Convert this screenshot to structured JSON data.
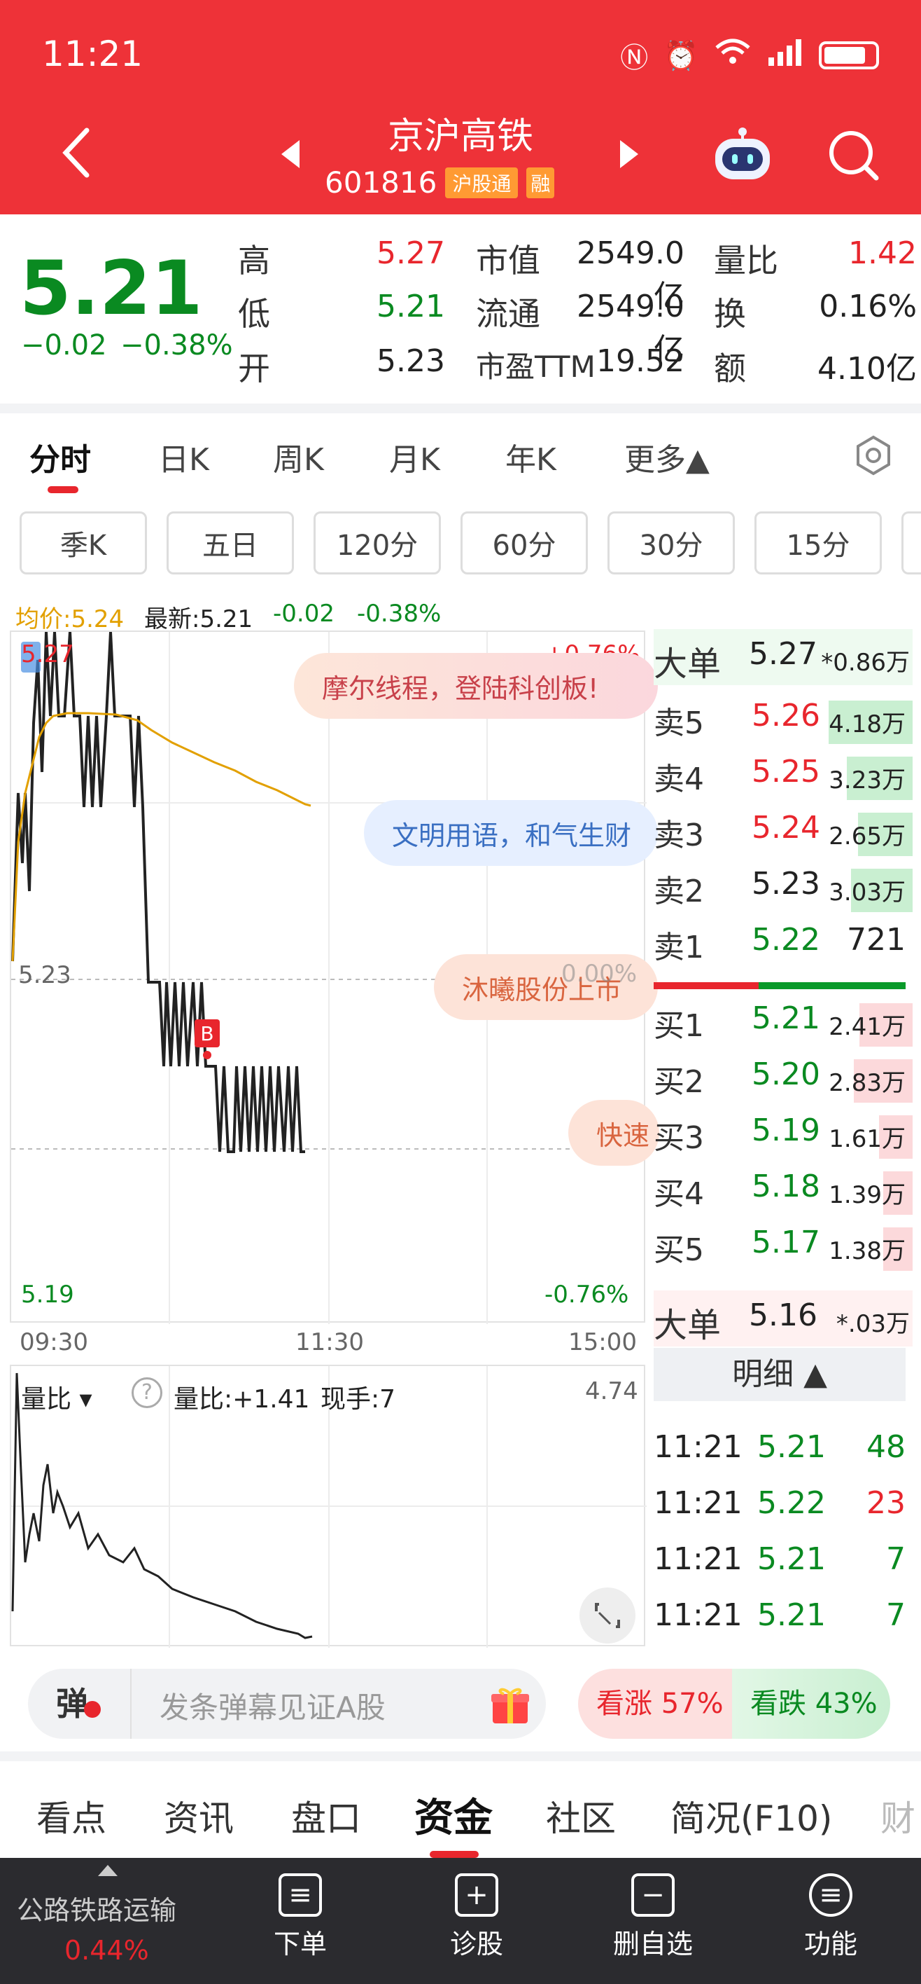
{
  "status": {
    "time": "11:21"
  },
  "header": {
    "title": "京沪高铁",
    "code": "601816",
    "tag_hgt": "沪股通",
    "tag_rong": "融"
  },
  "quote": {
    "price": "5.21",
    "change": "−0.02",
    "change_pct": "−0.38%",
    "high_label": "高",
    "high": "5.27",
    "low_label": "低",
    "low": "5.21",
    "open_label": "开",
    "open": "5.23",
    "mktcap_label": "市值",
    "mktcap": "2549.0亿",
    "float_label": "流通",
    "float": "2549.0亿",
    "pe_label": "市盈TTM",
    "pe": "19.52",
    "volratio_label": "量比",
    "volratio": "1.42",
    "turnover_label": "换",
    "turnover": "0.16%",
    "amount_label": "额",
    "amount": "4.10亿"
  },
  "period_tabs": [
    "分时",
    "日K",
    "周K",
    "月K",
    "年K",
    "更多▲"
  ],
  "period_pills": [
    "季K",
    "五日",
    "120分",
    "60分",
    "30分",
    "15分"
  ],
  "chart_info": {
    "avg": "均价:5.24",
    "latest": "最新:5.21",
    "chg": "-0.02",
    "pct": "-0.38%"
  },
  "chart_axes": {
    "y_top": "5.27",
    "y_mid": "5.23",
    "y_bottom": "5.19",
    "pct_top": "+0.76%",
    "pct_mid": "0.00%",
    "pct_bottom": "-0.76%",
    "x_start": "09:30",
    "x_mid": "11:30",
    "x_end": "15:00",
    "b_marker": "B"
  },
  "bubbles": [
    "摩尔线程，登陆科创板!",
    "文明用语，和气生财",
    "沐曦股份上市",
    "快速"
  ],
  "volume": {
    "selector": "量比",
    "ratio": "量比:+1.41",
    "now": "现手:7",
    "max": "4.74"
  },
  "orderbook": {
    "big_sell_label": "大单",
    "big_sell_price": "5.27",
    "big_sell_vol": "*0.86万",
    "asks": [
      {
        "label": "卖5",
        "price": "5.26",
        "vol": "4.18万"
      },
      {
        "label": "卖4",
        "price": "5.25",
        "vol": "3.23万"
      },
      {
        "label": "卖3",
        "price": "5.24",
        "vol": "2.65万"
      },
      {
        "label": "卖2",
        "price": "5.23",
        "vol": "3.03万"
      },
      {
        "label": "卖1",
        "price": "5.22",
        "vol": "721"
      }
    ],
    "bids": [
      {
        "label": "买1",
        "price": "5.21",
        "vol": "2.41万"
      },
      {
        "label": "买2",
        "price": "5.20",
        "vol": "2.83万"
      },
      {
        "label": "买3",
        "price": "5.19",
        "vol": "1.61万"
      },
      {
        "label": "买4",
        "price": "5.18",
        "vol": "1.39万"
      },
      {
        "label": "买5",
        "price": "5.17",
        "vol": "1.38万"
      }
    ],
    "big_buy_label": "大单",
    "big_buy_price": "5.16",
    "big_buy_vol": "*.03万",
    "detail_header": "明细 ▲",
    "details": [
      {
        "time": "11:21",
        "price": "5.21",
        "vol": "48"
      },
      {
        "time": "11:21",
        "price": "5.22",
        "vol": "23"
      },
      {
        "time": "11:21",
        "price": "5.21",
        "vol": "7"
      },
      {
        "time": "11:21",
        "price": "5.21",
        "vol": "7"
      }
    ]
  },
  "danmu": {
    "icon": "弹",
    "placeholder": "发条弹幕见证A股",
    "up": "看涨 57%",
    "down": "看跌 43%"
  },
  "sub_tabs": [
    "看点",
    "资讯",
    "盘口",
    "资金",
    "社区",
    "简况(F10)",
    "财"
  ],
  "footer": {
    "sector": "公路铁路运输",
    "sector_pct": "0.44%",
    "items": [
      "下单",
      "诊股",
      "删自选",
      "功能"
    ]
  },
  "colors": {
    "header_red": "#ee3238",
    "up": "#e8262d",
    "down": "#0a8a21"
  }
}
